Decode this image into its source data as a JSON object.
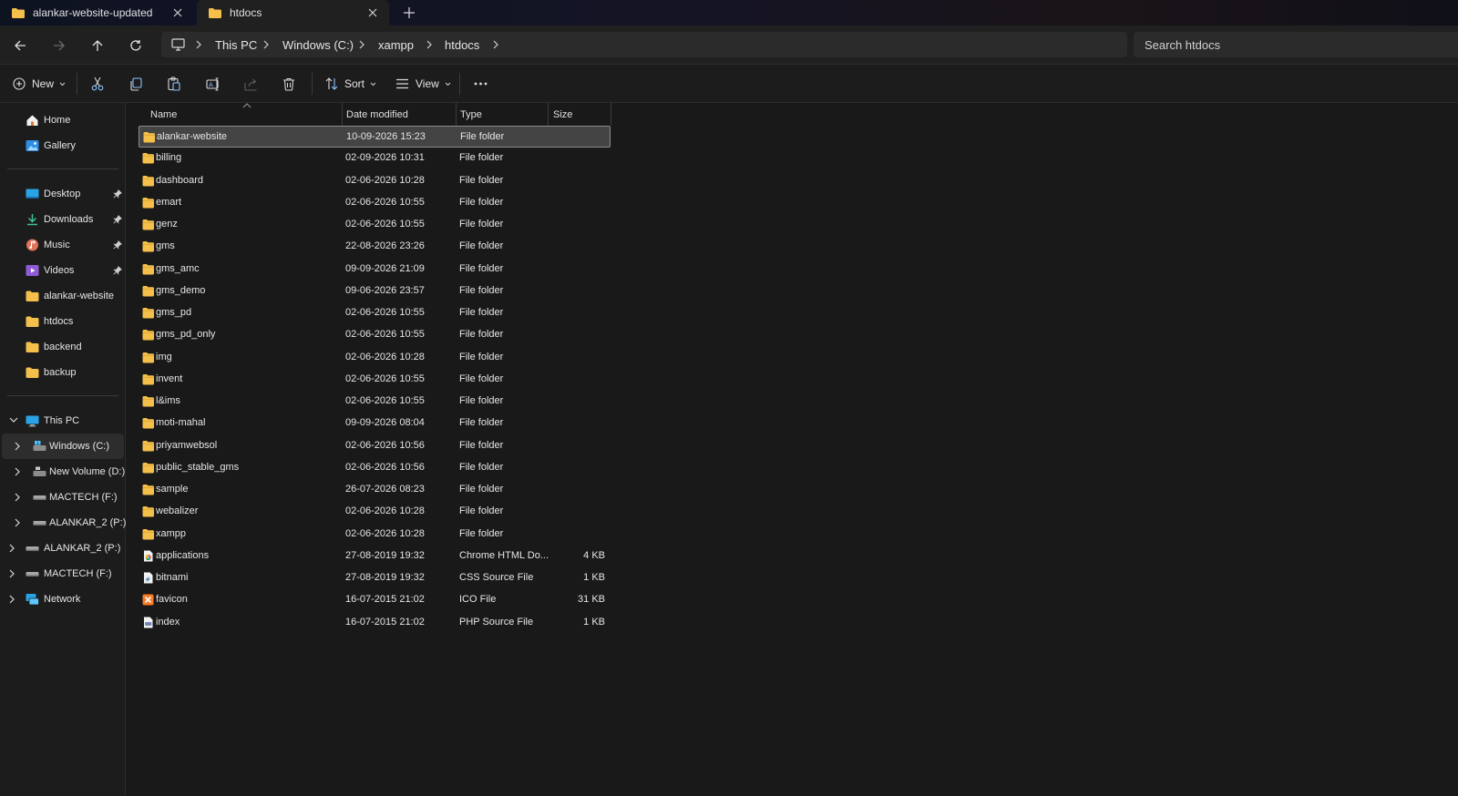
{
  "tabs": [
    {
      "title": "alankar-website-updated",
      "active": false
    },
    {
      "title": "htdocs",
      "active": true
    }
  ],
  "address": {
    "root_icon": "computer-icon",
    "crumbs": [
      "This PC",
      "Windows (C:)",
      "xampp",
      "htdocs"
    ]
  },
  "search": {
    "placeholder": "Search htdocs"
  },
  "toolbar": {
    "new_label": "New",
    "sort_label": "Sort",
    "view_label": "View",
    "icons": [
      "cut-icon",
      "copy-icon",
      "paste-icon",
      "rename-icon",
      "share-icon",
      "delete-icon",
      "more-icon"
    ]
  },
  "sidebar": {
    "quick": [
      {
        "label": "Home",
        "icon": "home-icon"
      },
      {
        "label": "Gallery",
        "icon": "gallery-icon"
      }
    ],
    "pinned": [
      {
        "label": "Desktop",
        "icon": "desktop-icon",
        "pinned": true
      },
      {
        "label": "Downloads",
        "icon": "downloads-icon",
        "pinned": true
      },
      {
        "label": "Music",
        "icon": "music-icon",
        "pinned": true
      },
      {
        "label": "Videos",
        "icon": "videos-icon",
        "pinned": true
      },
      {
        "label": "alankar-website",
        "icon": "folder-icon",
        "pinned": false
      },
      {
        "label": "htdocs",
        "icon": "folder-icon",
        "pinned": false
      },
      {
        "label": "backend",
        "icon": "folder-icon",
        "pinned": false
      },
      {
        "label": "backup",
        "icon": "folder-icon",
        "pinned": false
      }
    ],
    "tree": [
      {
        "label": "This PC",
        "icon": "this-pc-icon",
        "level": 0,
        "expanded": true,
        "selected": false
      },
      {
        "label": "Windows (C:)",
        "icon": "windows-drive-icon",
        "level": 1,
        "expanded": false,
        "selected": true
      },
      {
        "label": "New Volume (D:)",
        "icon": "drive-icon",
        "level": 1,
        "expanded": false,
        "selected": false
      },
      {
        "label": "MACTECH (F:)",
        "icon": "usb-drive-icon",
        "level": 1,
        "expanded": false,
        "selected": false
      },
      {
        "label": "ALANKAR_2 (P:)",
        "icon": "usb-drive-icon",
        "level": 1,
        "expanded": false,
        "selected": false
      },
      {
        "label": "ALANKAR_2 (P:)",
        "icon": "usb-drive-icon",
        "level": 0,
        "expanded": false,
        "selected": false
      },
      {
        "label": "MACTECH (F:)",
        "icon": "usb-drive-icon",
        "level": 0,
        "expanded": false,
        "selected": false
      },
      {
        "label": "Network",
        "icon": "network-icon",
        "level": 0,
        "expanded": false,
        "selected": false
      }
    ]
  },
  "columns": {
    "name": "Name",
    "date": "Date modified",
    "type": "Type",
    "size": "Size"
  },
  "files": [
    {
      "name": "alankar-website",
      "date": "10-09-2026 15:23",
      "type": "File folder",
      "size": "",
      "icon": "folder-icon",
      "selected": true
    },
    {
      "name": "billing",
      "date": "02-09-2026 10:31",
      "type": "File folder",
      "size": "",
      "icon": "folder-icon"
    },
    {
      "name": "dashboard",
      "date": "02-06-2026 10:28",
      "type": "File folder",
      "size": "",
      "icon": "folder-icon"
    },
    {
      "name": "emart",
      "date": "02-06-2026 10:55",
      "type": "File folder",
      "size": "",
      "icon": "folder-icon"
    },
    {
      "name": "genz",
      "date": "02-06-2026 10:55",
      "type": "File folder",
      "size": "",
      "icon": "folder-icon"
    },
    {
      "name": "gms",
      "date": "22-08-2026 23:26",
      "type": "File folder",
      "size": "",
      "icon": "folder-icon"
    },
    {
      "name": "gms_amc",
      "date": "09-09-2026 21:09",
      "type": "File folder",
      "size": "",
      "icon": "folder-icon"
    },
    {
      "name": "gms_demo",
      "date": "09-06-2026 23:57",
      "type": "File folder",
      "size": "",
      "icon": "folder-icon"
    },
    {
      "name": "gms_pd",
      "date": "02-06-2026 10:55",
      "type": "File folder",
      "size": "",
      "icon": "folder-icon"
    },
    {
      "name": "gms_pd_only",
      "date": "02-06-2026 10:55",
      "type": "File folder",
      "size": "",
      "icon": "folder-icon"
    },
    {
      "name": "img",
      "date": "02-06-2026 10:28",
      "type": "File folder",
      "size": "",
      "icon": "folder-icon"
    },
    {
      "name": "invent",
      "date": "02-06-2026 10:55",
      "type": "File folder",
      "size": "",
      "icon": "folder-icon"
    },
    {
      "name": "l&ims",
      "date": "02-06-2026 10:55",
      "type": "File folder",
      "size": "",
      "icon": "folder-icon"
    },
    {
      "name": "moti-mahal",
      "date": "09-09-2026 08:04",
      "type": "File folder",
      "size": "",
      "icon": "folder-icon"
    },
    {
      "name": "priyamwebsol",
      "date": "02-06-2026 10:56",
      "type": "File folder",
      "size": "",
      "icon": "folder-icon"
    },
    {
      "name": "public_stable_gms",
      "date": "02-06-2026 10:56",
      "type": "File folder",
      "size": "",
      "icon": "folder-icon"
    },
    {
      "name": "sample",
      "date": "26-07-2026 08:23",
      "type": "File folder",
      "size": "",
      "icon": "folder-icon"
    },
    {
      "name": "webalizer",
      "date": "02-06-2026 10:28",
      "type": "File folder",
      "size": "",
      "icon": "folder-icon"
    },
    {
      "name": "xampp",
      "date": "02-06-2026 10:28",
      "type": "File folder",
      "size": "",
      "icon": "folder-icon"
    },
    {
      "name": "applications",
      "date": "27-08-2019 19:32",
      "type": "Chrome HTML Do...",
      "size": "4 KB",
      "icon": "chrome-html-icon"
    },
    {
      "name": "bitnami",
      "date": "27-08-2019 19:32",
      "type": "CSS Source File",
      "size": "1 KB",
      "icon": "css-file-icon"
    },
    {
      "name": "favicon",
      "date": "16-07-2015 21:02",
      "type": "ICO File",
      "size": "31 KB",
      "icon": "xampp-ico-icon"
    },
    {
      "name": "index",
      "date": "16-07-2015 21:02",
      "type": "PHP Source File",
      "size": "1 KB",
      "icon": "php-file-icon"
    }
  ],
  "colors": {
    "folder": "#f4c04b",
    "accent": "#4cc2ff",
    "bg": "#191919"
  }
}
